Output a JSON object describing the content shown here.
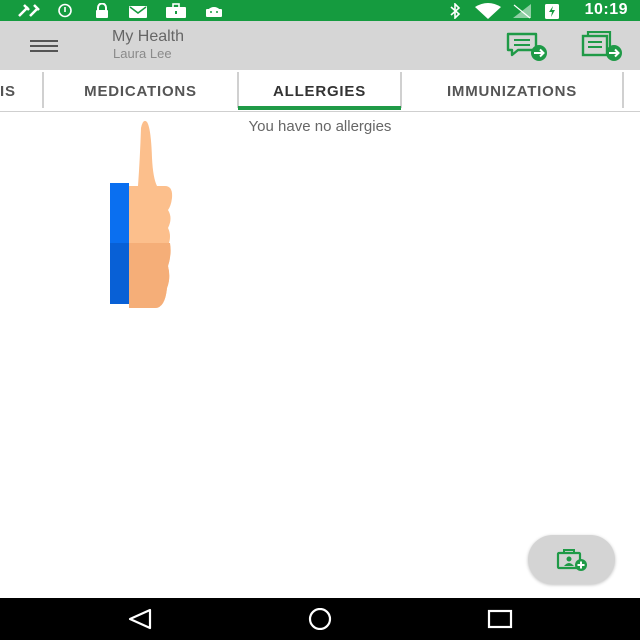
{
  "status_bar": {
    "time": "10:19",
    "background_color": "#159b3f",
    "left_icons": [
      "tools-icon",
      "sync-icon",
      "lock-icon",
      "mail-icon",
      "briefcase-icon",
      "android-icon"
    ],
    "right_icons": [
      "bluetooth-icon",
      "wifi-icon",
      "no-signal-icon",
      "battery-icon"
    ]
  },
  "app_bar": {
    "title": "My Health",
    "subtitle": "Laura Lee",
    "menu_icon": "hamburger-menu-icon",
    "action_icons": [
      "send-message-icon",
      "send-record-icon"
    ]
  },
  "tabs": {
    "items": [
      {
        "label": "IS",
        "selected": false
      },
      {
        "label": "MEDICATIONS",
        "selected": false
      },
      {
        "label": "ALLERGIES",
        "selected": true
      },
      {
        "label": "IMMUNIZATIONS",
        "selected": false
      }
    ],
    "indicator_color": "#1f9a47"
  },
  "content": {
    "empty_message": "You have no allergies"
  },
  "fab": {
    "icon": "add-record-icon"
  },
  "nav_bar": {
    "icons": [
      "back-icon",
      "home-icon",
      "recents-icon"
    ]
  }
}
